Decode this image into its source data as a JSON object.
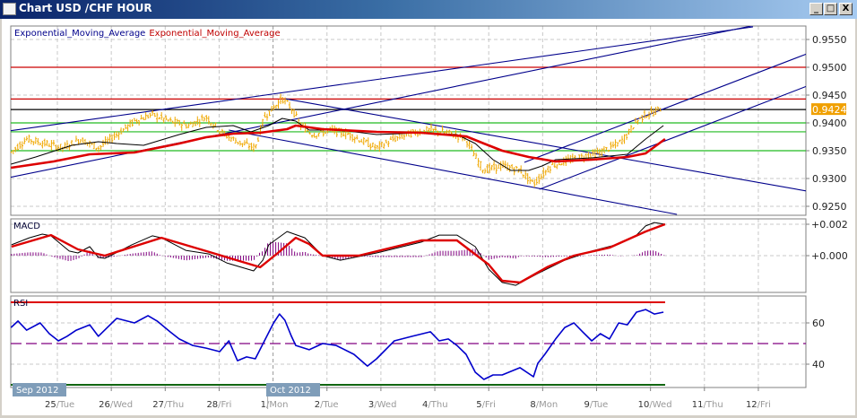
{
  "window": {
    "title": "Chart USD /CHF  HOUR",
    "minimize_icon": "minimize-icon",
    "maximize_icon": "maximize-icon",
    "close_icon": "close-icon",
    "minimize_label": "_",
    "maximize_label": "□",
    "close_label": "X"
  },
  "colors": {
    "candle": "#f0a800",
    "ema_fast": "#000000",
    "ema_slow": "#dd0000",
    "trendline": "#00008b",
    "level_red": "#cc0000",
    "level_green": "#22bb22",
    "histogram": "#800080",
    "price_tag": "#f0a000"
  },
  "chart_data": [
    {
      "type": "line",
      "title": "Chart USD /CHF HOUR",
      "legend": [
        {
          "label": "Exponential_Moving_Average",
          "color": "#00008b"
        },
        {
          "label": "Exponential_Moving_Average",
          "color": "#c00000"
        }
      ],
      "legend_placement": "top-left",
      "x_unit": "trading days from 25/Tue",
      "yticks": [
        "0.9550",
        "0.9500",
        "0.9450",
        "0.9400",
        "0.9350",
        "0.9300",
        "0.9250"
      ],
      "ylim": [
        0.923,
        0.9575
      ],
      "current_price": "0.9424",
      "grid": true,
      "price": [
        [
          -0.86,
          0.9347
        ],
        [
          -0.57,
          0.9371
        ],
        [
          -0.23,
          0.9363
        ],
        [
          0.1,
          0.9355
        ],
        [
          0.43,
          0.9371
        ],
        [
          0.76,
          0.9355
        ],
        [
          1.1,
          0.9379
        ],
        [
          1.43,
          0.9403
        ],
        [
          1.76,
          0.9415
        ],
        [
          2.09,
          0.9403
        ],
        [
          2.43,
          0.9395
        ],
        [
          2.76,
          0.9411
        ],
        [
          3.09,
          0.9379
        ],
        [
          3.42,
          0.9363
        ],
        [
          3.67,
          0.9355
        ],
        [
          3.84,
          0.9411
        ],
        [
          4.01,
          0.9427
        ],
        [
          4.17,
          0.9444
        ],
        [
          4.34,
          0.9427
        ],
        [
          4.51,
          0.9395
        ],
        [
          4.75,
          0.9379
        ],
        [
          5.09,
          0.9387
        ],
        [
          5.42,
          0.9379
        ],
        [
          5.75,
          0.9363
        ],
        [
          5.92,
          0.9355
        ],
        [
          6.25,
          0.9371
        ],
        [
          6.58,
          0.9382
        ],
        [
          6.92,
          0.9387
        ],
        [
          7.25,
          0.9382
        ],
        [
          7.58,
          0.9371
        ],
        [
          7.75,
          0.9339
        ],
        [
          7.91,
          0.9315
        ],
        [
          8.25,
          0.9323
        ],
        [
          8.58,
          0.9315
        ],
        [
          8.83,
          0.929
        ],
        [
          8.99,
          0.9306
        ],
        [
          9.16,
          0.9323
        ],
        [
          9.41,
          0.9331
        ],
        [
          9.74,
          0.9339
        ],
        [
          10.07,
          0.9347
        ],
        [
          10.41,
          0.9363
        ],
        [
          10.57,
          0.9379
        ],
        [
          10.74,
          0.9403
        ],
        [
          10.91,
          0.9415
        ],
        [
          11.07,
          0.9419
        ],
        [
          11.21,
          0.9427
        ]
      ],
      "ema_fast": [
        [
          -0.86,
          0.93258
        ],
        [
          -0.4,
          0.93387
        ],
        [
          0.27,
          0.93597
        ],
        [
          0.76,
          0.93661
        ],
        [
          1.1,
          0.93629
        ],
        [
          1.6,
          0.93597
        ],
        [
          2.26,
          0.9379
        ],
        [
          2.76,
          0.93919
        ],
        [
          3.26,
          0.93952
        ],
        [
          3.59,
          0.93839
        ],
        [
          3.92,
          0.93952
        ],
        [
          4.17,
          0.94081
        ],
        [
          4.42,
          0.94032
        ],
        [
          4.67,
          0.93871
        ],
        [
          5.25,
          0.93871
        ],
        [
          5.92,
          0.9379
        ],
        [
          6.75,
          0.93823
        ],
        [
          7.41,
          0.9379
        ],
        [
          7.75,
          0.93629
        ],
        [
          8.08,
          0.93339
        ],
        [
          8.41,
          0.93145
        ],
        [
          8.74,
          0.93145
        ],
        [
          8.99,
          0.93226
        ],
        [
          9.24,
          0.93339
        ],
        [
          9.91,
          0.93371
        ],
        [
          10.57,
          0.93435
        ],
        [
          10.91,
          0.9371
        ],
        [
          11.24,
          0.93952
        ]
      ],
      "ema_slow": [
        [
          -0.86,
          0.93194
        ],
        [
          -0.07,
          0.93306
        ],
        [
          0.6,
          0.93435
        ],
        [
          1.43,
          0.93468
        ],
        [
          2.26,
          0.93629
        ],
        [
          2.76,
          0.93742
        ],
        [
          3.26,
          0.93806
        ],
        [
          3.76,
          0.93823
        ],
        [
          4.26,
          0.93887
        ],
        [
          4.42,
          0.93952
        ],
        [
          4.92,
          0.93887
        ],
        [
          5.92,
          0.93839
        ],
        [
          6.75,
          0.93823
        ],
        [
          7.58,
          0.93758
        ],
        [
          7.91,
          0.93629
        ],
        [
          8.25,
          0.935
        ],
        [
          8.74,
          0.93387
        ],
        [
          9.24,
          0.93306
        ],
        [
          9.91,
          0.93339
        ],
        [
          10.57,
          0.93387
        ],
        [
          10.91,
          0.93452
        ],
        [
          11.27,
          0.9371
        ]
      ],
      "levels": [
        {
          "price": 0.95,
          "color": "#cc0000"
        },
        {
          "price": 0.9443,
          "color": "#cc0000"
        },
        {
          "price": 0.9424,
          "color": "#000000"
        },
        {
          "price": 0.94,
          "color": "#22bb22"
        },
        {
          "price": 0.9384,
          "color": "#22bb22"
        },
        {
          "price": 0.935,
          "color": "#22bb22"
        }
      ],
      "trendlines": [
        [
          [
            -0.9,
            0.93855
          ],
          [
            12.9,
            0.95726
          ]
        ],
        [
          [
            -0.9,
            0.93016
          ],
          [
            12.95,
            0.95758
          ]
        ],
        [
          [
            8.66,
            0.9329
          ],
          [
            13.9,
            0.95242
          ]
        ],
        [
          [
            8.94,
            0.92806
          ],
          [
            13.9,
            0.94661
          ]
        ],
        [
          [
            4.22,
            0.94435
          ],
          [
            13.9,
            0.92774
          ]
        ],
        [
          [
            3.18,
            0.93871
          ],
          [
            11.49,
            0.92355
          ]
        ]
      ]
    },
    {
      "type": "line",
      "title": "MACD",
      "y_unit": "0.001",
      "yticks": [
        "+0.002",
        "+0.000"
      ],
      "macd": [
        [
          -0.85,
          0.69
        ],
        [
          -0.52,
          1.14
        ],
        [
          -0.28,
          1.37
        ],
        [
          -0.12,
          1.26
        ],
        [
          0.22,
          0.29
        ],
        [
          0.38,
          0.17
        ],
        [
          0.6,
          0.57
        ],
        [
          0.76,
          -0.11
        ],
        [
          0.88,
          -0.17
        ],
        [
          1.05,
          0.11
        ],
        [
          1.38,
          0.69
        ],
        [
          1.76,
          1.26
        ],
        [
          1.93,
          1.14
        ],
        [
          2.38,
          0.34
        ],
        [
          2.81,
          0.11
        ],
        [
          3.14,
          -0.46
        ],
        [
          3.64,
          -0.97
        ],
        [
          3.81,
          -0.29
        ],
        [
          3.92,
          0.69
        ],
        [
          4.26,
          1.54
        ],
        [
          4.59,
          1.14
        ],
        [
          4.92,
          0
        ],
        [
          5.25,
          -0.29
        ],
        [
          5.92,
          0.17
        ],
        [
          6.75,
          0.86
        ],
        [
          7.08,
          1.31
        ],
        [
          7.41,
          1.31
        ],
        [
          7.75,
          0.57
        ],
        [
          8.0,
          -0.86
        ],
        [
          8.25,
          -1.71
        ],
        [
          8.5,
          -1.89
        ],
        [
          8.91,
          -1.14
        ],
        [
          9.41,
          -0.29
        ],
        [
          9.91,
          0.29
        ],
        [
          10.41,
          0.74
        ],
        [
          10.74,
          1.31
        ],
        [
          10.91,
          1.89
        ],
        [
          11.07,
          2.11
        ],
        [
          11.27,
          2.0
        ]
      ],
      "signal": [
        [
          -0.85,
          0.57
        ],
        [
          -0.12,
          1.31
        ],
        [
          0.38,
          0.4
        ],
        [
          0.88,
          0
        ],
        [
          1.93,
          1.14
        ],
        [
          2.76,
          0.29
        ],
        [
          3.76,
          -0.74
        ],
        [
          4.09,
          0.17
        ],
        [
          4.42,
          1.14
        ],
        [
          4.67,
          0.74
        ],
        [
          4.92,
          0
        ],
        [
          5.59,
          0
        ],
        [
          6.75,
          0.97
        ],
        [
          7.41,
          0.97
        ],
        [
          8.0,
          -0.57
        ],
        [
          8.25,
          -1.6
        ],
        [
          8.58,
          -1.71
        ],
        [
          9.08,
          -0.74
        ],
        [
          9.58,
          0
        ],
        [
          10.24,
          0.51
        ],
        [
          10.91,
          1.54
        ],
        [
          11.27,
          2.0
        ]
      ]
    },
    {
      "type": "line",
      "title": "RSI",
      "yticks": [
        "60",
        "40"
      ],
      "levels": [
        70,
        50,
        30
      ],
      "rsi": [
        [
          -0.86,
          57.8
        ],
        [
          -0.73,
          60.9
        ],
        [
          -0.57,
          56.5
        ],
        [
          -0.32,
          60
        ],
        [
          -0.15,
          54.8
        ],
        [
          0.02,
          51.3
        ],
        [
          0.18,
          53.5
        ],
        [
          0.35,
          56.5
        ],
        [
          0.6,
          59.1
        ],
        [
          0.76,
          53.5
        ],
        [
          1.1,
          62.2
        ],
        [
          1.43,
          60
        ],
        [
          1.68,
          63.5
        ],
        [
          1.85,
          60.9
        ],
        [
          2.09,
          55.7
        ],
        [
          2.26,
          52.2
        ],
        [
          2.51,
          49.1
        ],
        [
          2.76,
          47.8
        ],
        [
          3.01,
          46.1
        ],
        [
          3.18,
          51.3
        ],
        [
          3.34,
          41.7
        ],
        [
          3.51,
          43.5
        ],
        [
          3.67,
          42.6
        ],
        [
          3.84,
          51.3
        ],
        [
          4.01,
          60
        ],
        [
          4.12,
          64.3
        ],
        [
          4.22,
          61.3
        ],
        [
          4.34,
          53.5
        ],
        [
          4.42,
          49.1
        ],
        [
          4.67,
          47
        ],
        [
          4.92,
          50
        ],
        [
          5.17,
          49.1
        ],
        [
          5.5,
          44.8
        ],
        [
          5.75,
          39.1
        ],
        [
          5.92,
          42.6
        ],
        [
          6.25,
          51.3
        ],
        [
          6.58,
          53.5
        ],
        [
          6.92,
          55.7
        ],
        [
          7.08,
          51.3
        ],
        [
          7.25,
          52.2
        ],
        [
          7.41,
          49.1
        ],
        [
          7.58,
          44.8
        ],
        [
          7.75,
          36.1
        ],
        [
          7.91,
          32.6
        ],
        [
          8.08,
          34.8
        ],
        [
          8.25,
          34.8
        ],
        [
          8.58,
          38.3
        ],
        [
          8.83,
          33.9
        ],
        [
          8.91,
          40.4
        ],
        [
          9.04,
          44.8
        ],
        [
          9.24,
          52.2
        ],
        [
          9.41,
          57.8
        ],
        [
          9.58,
          60
        ],
        [
          9.74,
          55.7
        ],
        [
          9.91,
          51.3
        ],
        [
          10.07,
          54.8
        ],
        [
          10.24,
          52.2
        ],
        [
          10.41,
          60
        ],
        [
          10.57,
          59.1
        ],
        [
          10.74,
          65.2
        ],
        [
          10.91,
          66.5
        ],
        [
          11.07,
          64.3
        ],
        [
          11.24,
          65.2
        ]
      ]
    }
  ],
  "time_axis": {
    "months": [
      "Sep 2012",
      "Oct 2012"
    ],
    "days": [
      {
        "num": "25",
        "name": "/Tue"
      },
      {
        "num": "26",
        "name": "/Wed"
      },
      {
        "num": "27",
        "name": "/Thu"
      },
      {
        "num": "28",
        "name": "/Fri"
      },
      {
        "num": "1",
        "name": "/Mon"
      },
      {
        "num": "2",
        "name": "/Tue"
      },
      {
        "num": "3",
        "name": "/Wed"
      },
      {
        "num": "4",
        "name": "/Thu"
      },
      {
        "num": "5",
        "name": "/Fri"
      },
      {
        "num": "8",
        "name": "/Mon"
      },
      {
        "num": "9",
        "name": "/Tue"
      },
      {
        "num": "10",
        "name": "/Wed"
      },
      {
        "num": "11",
        "name": "/Thu"
      },
      {
        "num": "12",
        "name": "/Fri"
      }
    ]
  }
}
